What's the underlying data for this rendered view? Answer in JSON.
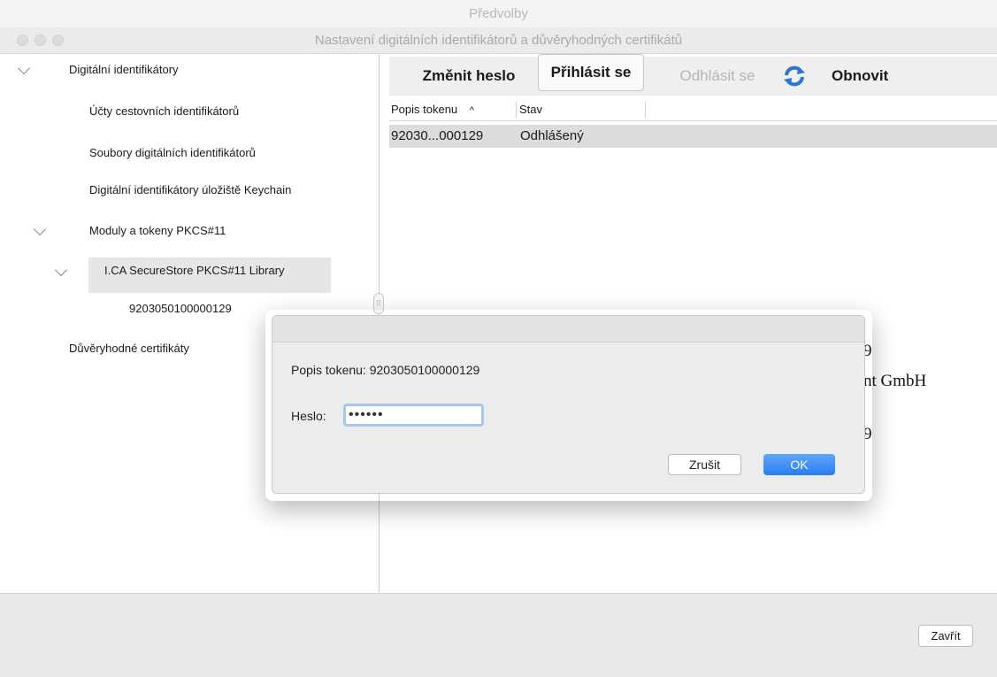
{
  "parent_window": {
    "title": "Předvolby"
  },
  "window": {
    "title": "Nastavení digitálních identifikátorů a důvěryhodných certifikátů"
  },
  "sidebar": {
    "items": [
      {
        "label": "Digitální identifikátory",
        "expanded": true
      },
      {
        "label": "Účty cestovních identifikátorů"
      },
      {
        "label": "Soubory digitálních identifikátorů"
      },
      {
        "label": "Digitální identifikátory úložiště Keychain"
      },
      {
        "label": "Moduly a tokeny PKCS#11",
        "expanded": true
      },
      {
        "label": "I.CA SecureStore PKCS#11 Library",
        "expanded": true,
        "selected": true
      },
      {
        "label": "9203050100000129"
      },
      {
        "label": "Důvěryhodné certifikáty"
      }
    ]
  },
  "toolbar": {
    "change_password": "Změnit heslo",
    "login": "Přihlásit se",
    "logout": "Odhlásit se",
    "refresh": "Obnovit"
  },
  "table": {
    "columns": [
      "Popis tokenu",
      "Stav"
    ],
    "sort_indicator": "^",
    "rows": [
      {
        "token": "92030...000129",
        "status": "Odhlášený"
      }
    ]
  },
  "background_details": {
    "line1": "9",
    "line2": "nt GmbH",
    "line3": "9"
  },
  "dialog": {
    "token_label": "Popis tokenu: 9203050100000129",
    "password_label": "Heslo:",
    "password_value": "••••••",
    "cancel": "Zrušit",
    "ok": "OK"
  },
  "footer": {
    "close": "Zavřít"
  },
  "colors": {
    "accent": "#2b7cf2",
    "focus_ring": "#a8c6ea",
    "selection": "#dcdcdc"
  }
}
